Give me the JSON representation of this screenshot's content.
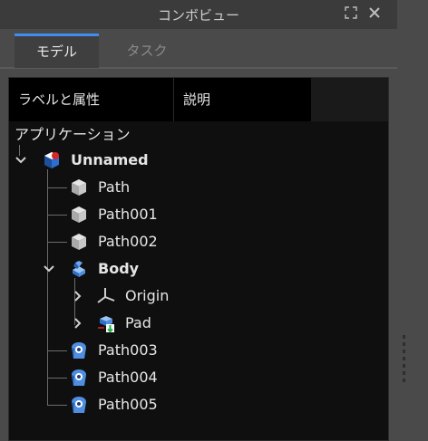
{
  "window": {
    "title": "コンボビュー",
    "float_icon": "float-icon",
    "close_icon": "close-icon"
  },
  "tabs": [
    {
      "label": "モデル",
      "active": true
    },
    {
      "label": "タスク",
      "active": false
    }
  ],
  "tree": {
    "columns": [
      "ラベルと属性",
      "説明"
    ],
    "root_label": "アプリケーション",
    "items": [
      {
        "label": "Unnamed",
        "icon": "document-icon",
        "expanded": true,
        "bold": true
      },
      {
        "label": "Path",
        "icon": "gray-cube-icon"
      },
      {
        "label": "Path001",
        "icon": "gray-cube-icon"
      },
      {
        "label": "Path002",
        "icon": "gray-cube-icon"
      },
      {
        "label": "Body",
        "icon": "body-icon",
        "expanded": true,
        "bold": true
      },
      {
        "label": "Origin",
        "icon": "origin-axes-icon",
        "expanded": false
      },
      {
        "label": "Pad",
        "icon": "pad-icon",
        "expanded": false
      },
      {
        "label": "Path003",
        "icon": "job-path-icon"
      },
      {
        "label": "Path004",
        "icon": "job-path-icon"
      },
      {
        "label": "Path005",
        "icon": "job-path-icon"
      }
    ]
  },
  "colors": {
    "accent": "#3d8ef0",
    "tree_bg": "#0f0f0f",
    "panel_bg": "#4a4a4a"
  }
}
